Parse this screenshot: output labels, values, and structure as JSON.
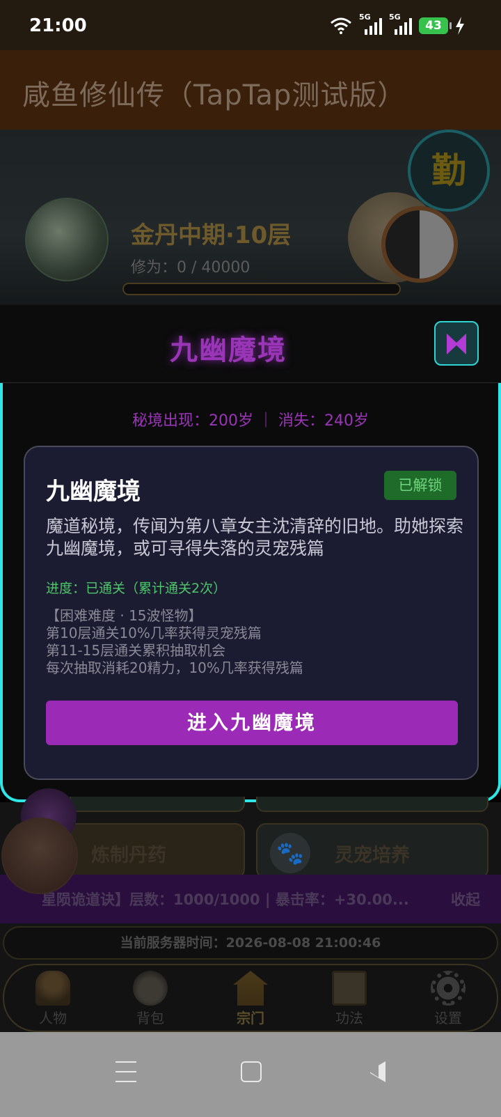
{
  "status_bar": {
    "time": "21:00",
    "network_1": "5G",
    "network_2": "5G",
    "battery": "43",
    "icons": [
      "wifi-icon",
      "signal-icon",
      "signal-icon",
      "battery-icon",
      "charging-icon"
    ]
  },
  "app": {
    "title": "咸鱼修仙传（TapTap测试版）"
  },
  "hero": {
    "realm": "金丹中期·10层",
    "cultivation": "修为：0 / 40000",
    "cultivation_progress": 0,
    "diligence_badge": "勤"
  },
  "modal": {
    "title": "九幽魔境",
    "appear_info": "秘境出现：200岁 ｜ 消失：240岁",
    "card": {
      "title": "九幽魔境",
      "badge": "已解锁",
      "description": "魔道秘境，传闻为第八章女主沈清辞的旧地。助她探索九幽魔境，或可寻得失落的灵宠残篇",
      "progress": "进度：已通关（累计通关2次）",
      "rules": [
        "【困难难度 · 15波怪物】",
        "第10层通关10%几率获得灵宠残篇",
        "第11-15层通关累积抽取机会",
        "每次抽取消耗20精力，10%几率获得残篇"
      ],
      "enter_button": "进入九幽魔境"
    },
    "close_icon": "close-icon"
  },
  "tiles": {
    "alchemy": "炼制丹药",
    "pet": "灵宠培养"
  },
  "buff_bar": {
    "text": "星陨诡道诀】层数：1000/1000 | 暴击率：+30.00...",
    "collapse": "收起"
  },
  "server_time": "当前服务器时间：2026-08-08 21:00:46",
  "nav": {
    "items": [
      {
        "label": "人物",
        "icon": "person-icon"
      },
      {
        "label": "背包",
        "icon": "bag-icon"
      },
      {
        "label": "宗门",
        "icon": "sect-icon"
      },
      {
        "label": "功法",
        "icon": "scroll-icon"
      },
      {
        "label": "设置",
        "icon": "gear-icon"
      }
    ],
    "active": "宗门"
  },
  "colors": {
    "accent_purple": "#9b2bb6",
    "modal_border": "#2fe6e6",
    "unlocked_green": "#1f6b2a"
  }
}
